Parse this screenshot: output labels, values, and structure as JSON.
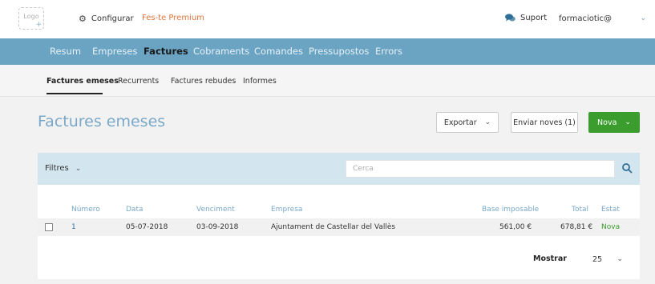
{
  "header": {
    "logo_text": "Logo",
    "logo_plus": "+",
    "configure_label": "Configurar",
    "premium_label": "Fes-te Premium",
    "support_label": "Suport",
    "user_name": "formaciotic@"
  },
  "nav": {
    "items": [
      {
        "label": "Resum"
      },
      {
        "label": "Empreses"
      },
      {
        "label": "Factures"
      },
      {
        "label": "Cobraments"
      },
      {
        "label": "Comandes"
      },
      {
        "label": "Pressupostos"
      },
      {
        "label": "Errors"
      }
    ],
    "active": "Factures"
  },
  "subnav": {
    "items": [
      {
        "label": "Factures emeses"
      },
      {
        "label": "Recurrents"
      },
      {
        "label": "Factures rebudes"
      },
      {
        "label": "Informes"
      }
    ],
    "active": "Factures emeses"
  },
  "main": {
    "title": "Factures emeses",
    "export_label": "Exportar",
    "send_label": "Enviar noves (1)",
    "new_label": "Nova"
  },
  "filters": {
    "label": "Filtres",
    "search_placeholder": "Cerca"
  },
  "table": {
    "columns": {
      "number": "Número",
      "date": "Data",
      "due": "Venciment",
      "company": "Empresa",
      "base": "Base imposable",
      "total": "Total",
      "status": "Estat"
    },
    "rows": [
      {
        "number": "1",
        "date": "05-07-2018",
        "due": "03-09-2018",
        "company": "Ajuntament de Castellar del Vallès",
        "base": "561,00 €",
        "total": "678,81 €",
        "status": "Nova"
      }
    ]
  },
  "pagination": {
    "show_label": "Mostrar",
    "per_page": "25"
  },
  "colors": {
    "nav_bar": "#6ba3c3",
    "filter_bar": "#d3e6f0",
    "primary_green": "#3a9d2d",
    "premium_orange": "#e0763a",
    "link_blue": "#2e6e97"
  }
}
